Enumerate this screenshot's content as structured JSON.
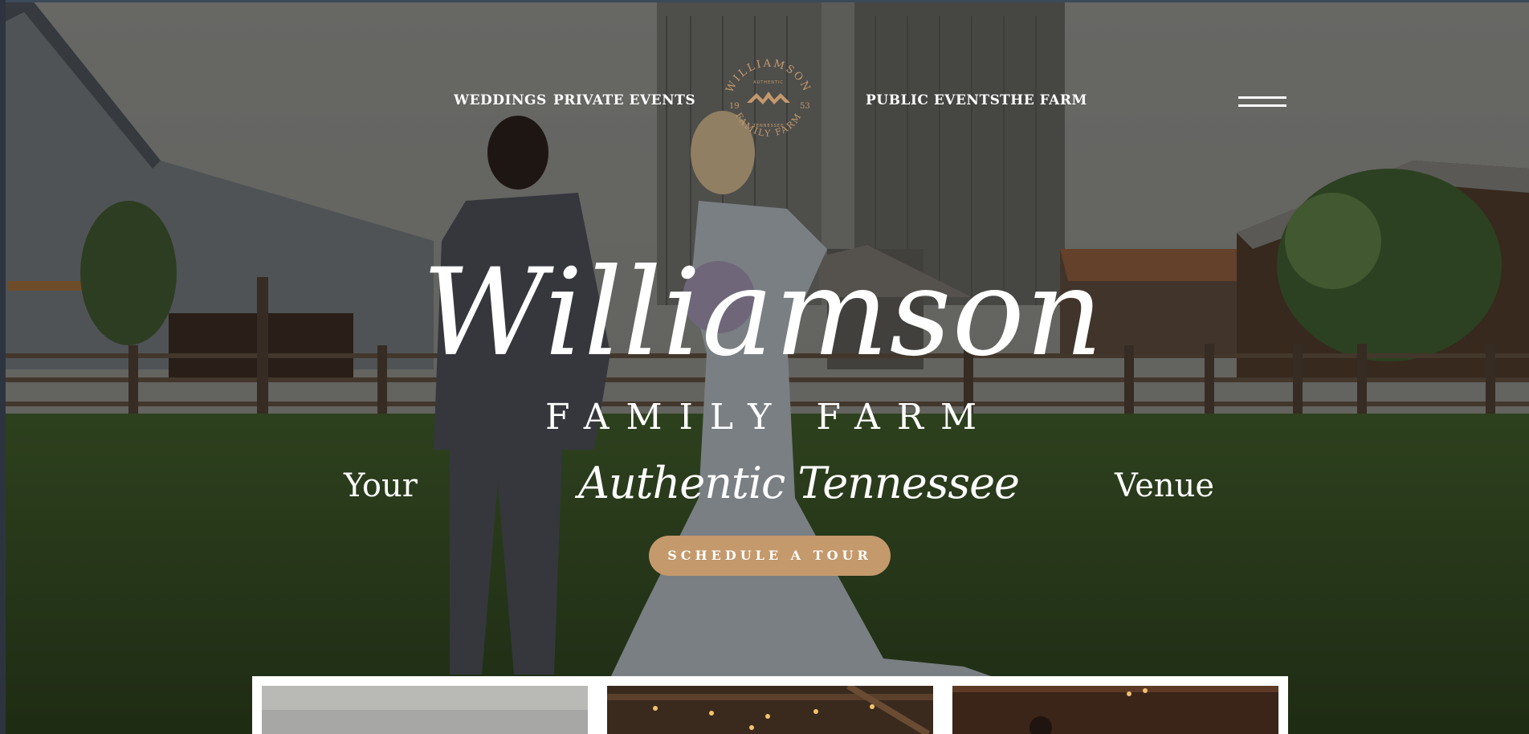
{
  "nav": {
    "left_links": [
      "WEDDINGS",
      "PRIVATE EVENTS"
    ],
    "right_links": [
      "PUBLIC EVENTS",
      "THE FARM"
    ],
    "menu_icon": "hamburger-menu-icon"
  },
  "logo": {
    "name": "WILLIAMSON",
    "subtitle": "FAMILY FARM",
    "top_small": "AUTHENTIC",
    "bottom_small": "TENNESSEE",
    "year_left": "19",
    "year_right": "53"
  },
  "hero": {
    "title_script": "Williamson",
    "title_caps": "FAMILY FARM",
    "tagline_left": "Your",
    "tagline_script": "Authentic Tennessee",
    "tagline_right": "Venue",
    "cta_label": "SCHEDULE A TOUR"
  },
  "colors": {
    "accent": "#c4996c",
    "text": "#ffffff",
    "panel": "#ffffff"
  },
  "cards": [
    {
      "name": "card-sky-photo"
    },
    {
      "name": "card-string-lights-photo"
    },
    {
      "name": "card-barn-interior-photo"
    }
  ]
}
